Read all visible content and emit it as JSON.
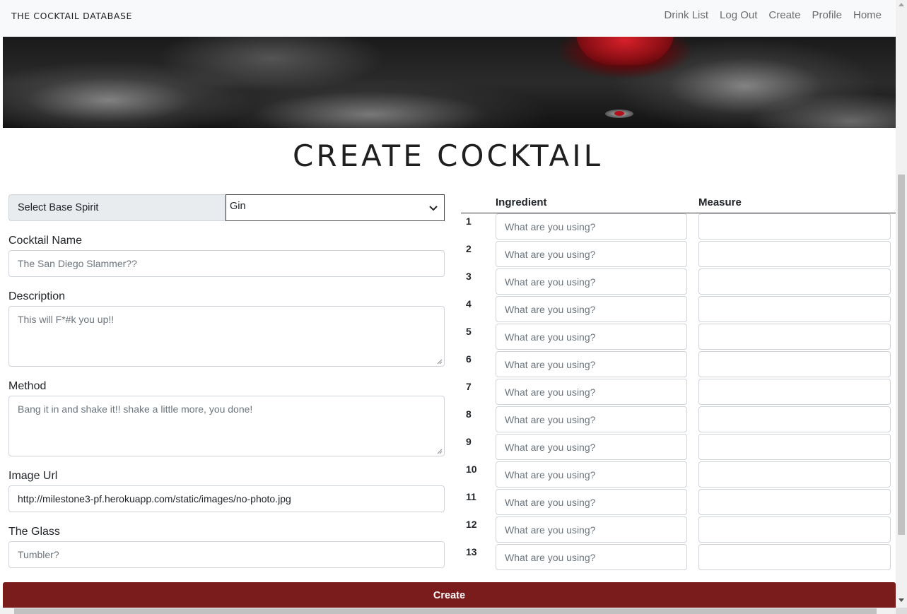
{
  "navbar": {
    "brand": "THE COCKTAIL DATABASE",
    "links": [
      "Drink List",
      "Log Out",
      "Create",
      "Profile",
      "Home"
    ]
  },
  "page_title": "CREATE COCKTAIL",
  "form": {
    "base_spirit_label": "Select Base Spirit",
    "base_spirit_value": "Gin",
    "name_label": "Cocktail Name",
    "name_value": "The San Diego Slammer??",
    "description_label": "Description",
    "description_value": "This will F*#k you up!!",
    "method_label": "Method",
    "method_value": "Bang it in and shake it!! shake a little more, you done!",
    "image_url_label": "Image Url",
    "image_url_value": "http://milestone3-pf.herokuapp.com/static/images/no-photo.jpg",
    "glass_label": "The Glass",
    "glass_value": "Tumbler?"
  },
  "ingredients_table": {
    "col_ingredient": "Ingredient",
    "col_measure": "Measure",
    "placeholder": "What are you using?",
    "row_numbers": [
      "1",
      "2",
      "3",
      "4",
      "5",
      "6",
      "7",
      "8",
      "9",
      "10",
      "11",
      "12",
      "13"
    ]
  },
  "submit_label": "Create",
  "colors": {
    "accent": "#7a1c1c",
    "navbar_bg": "#f8f9fa"
  }
}
